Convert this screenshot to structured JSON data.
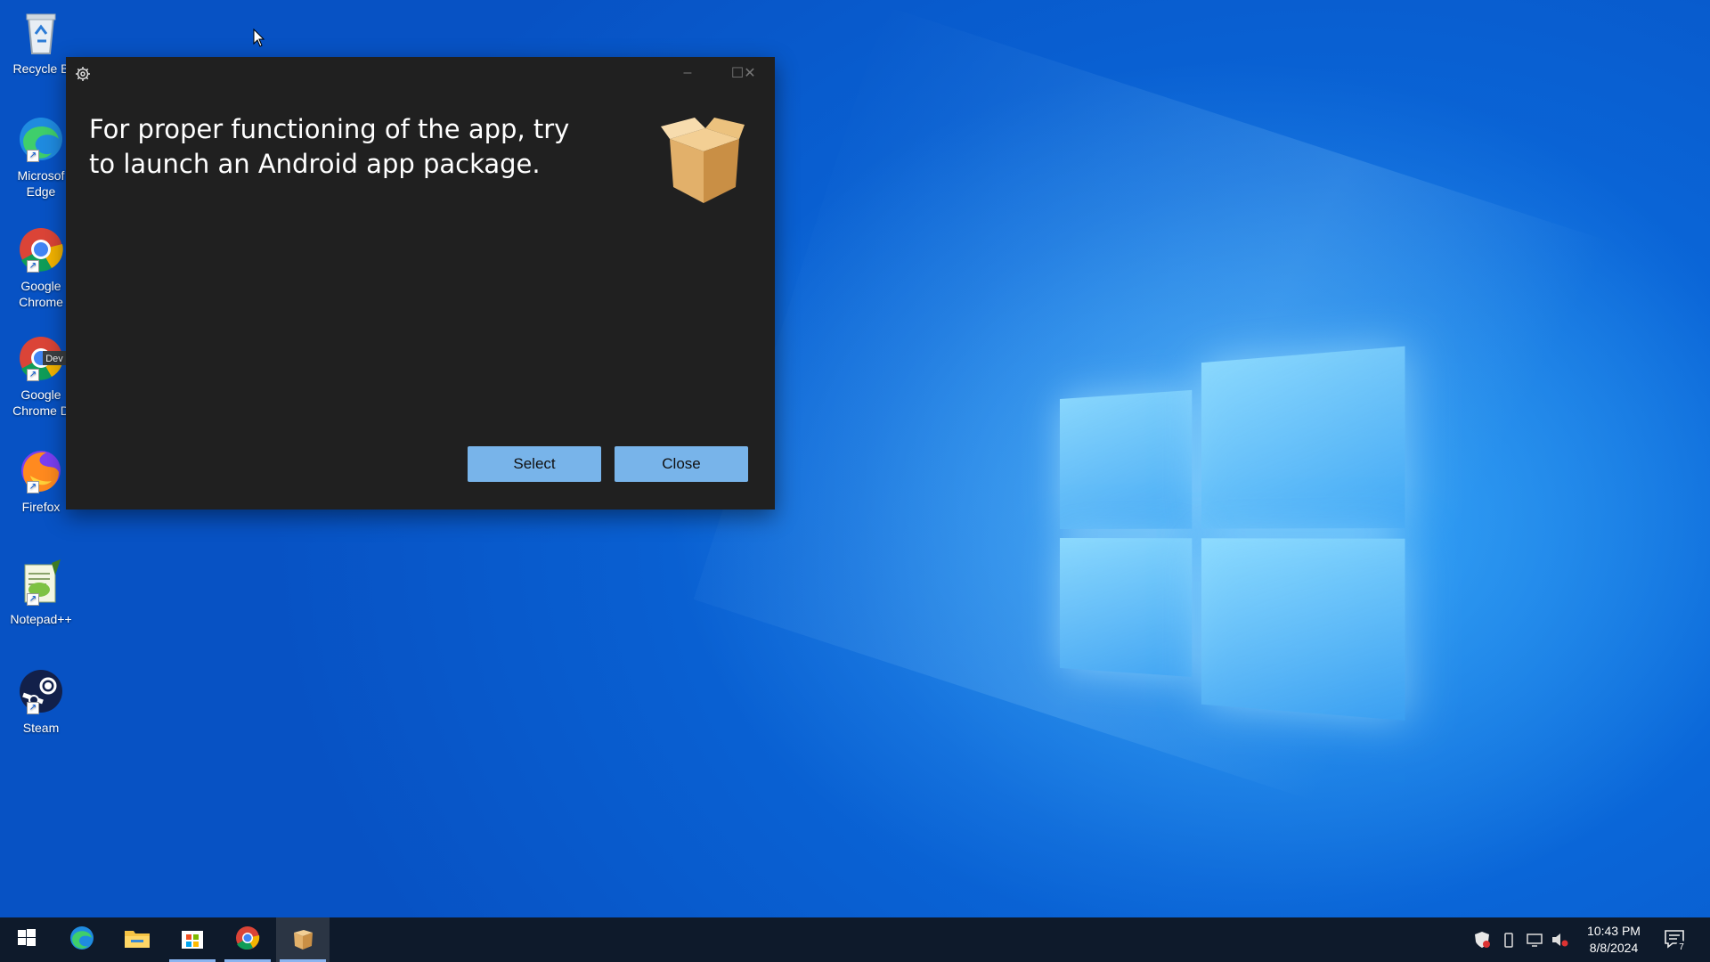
{
  "desktop": {
    "icons": [
      {
        "label": "Recycle B",
        "icon": "recycle-bin-icon"
      },
      {
        "label": "Microsoft Edge",
        "label_line1": "Microsof",
        "label_line2": "Edge",
        "icon": "edge-icon"
      },
      {
        "label_line1": "Google",
        "label_line2": "Chrome",
        "icon": "chrome-icon"
      },
      {
        "label_line1": "Google",
        "label_line2": "Chrome D",
        "badge": "Dev",
        "icon": "chrome-dev-icon"
      },
      {
        "label": "Firefox",
        "icon": "firefox-icon"
      },
      {
        "label": "Notepad++",
        "icon": "notepadpp-icon"
      },
      {
        "label": "Steam",
        "icon": "steam-icon"
      }
    ]
  },
  "app_window": {
    "message": "For proper functioning of the app, try to launch an Android app package.",
    "select_label": "Select",
    "close_label": "Close",
    "controls": {
      "minimize": "–",
      "maximize": "☐",
      "close": "✕"
    }
  },
  "taskbar": {
    "items": [
      "start-icon",
      "edge-icon",
      "file-explorer-icon",
      "store-icon",
      "chrome-dev-icon",
      "package-app-icon"
    ],
    "clock": {
      "time": "10:43 PM",
      "date": "8/8/2024"
    },
    "notification_count": "7"
  },
  "colors": {
    "window_bg": "#202020",
    "button_bg": "#78b4ea",
    "taskbar_bg": "#0e1a2b",
    "wallpaper": "#0a66d8"
  }
}
